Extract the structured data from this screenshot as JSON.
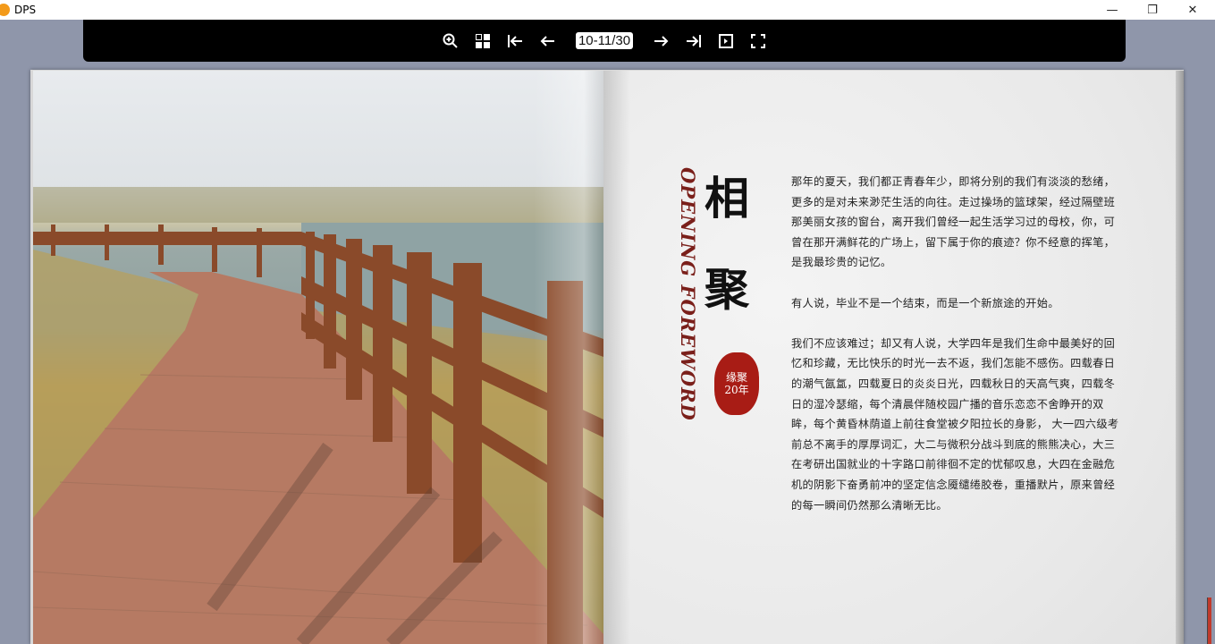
{
  "window": {
    "title": "DPS",
    "app_icon": "DPS",
    "controls": {
      "minimize": "—",
      "restore": "❐",
      "close": "✕"
    }
  },
  "toolbar": {
    "page_indicator": "10-11/30",
    "icons": [
      "zoom-in-icon",
      "thumbnails-icon",
      "first-page-icon",
      "prev-page-icon",
      "next-page-icon",
      "last-page-icon",
      "autoplay-icon",
      "fullscreen-icon"
    ]
  },
  "page": {
    "vertical_title": "OPENING FOREWORD",
    "title_chars": [
      "相",
      "聚"
    ],
    "stamp": {
      "line1": "缘聚",
      "line2": "20年"
    },
    "paragraphs": [
      "那年的夏天，我们都正青春年少，即将分别的我们有淡淡的愁绪，更多的是对未来渺茫生活的向往。走过操场的篮球架，经过隔壁班那美丽女孩的窗台，离开我们曾经一起生活学习过的母校，你，可曾在那开满鲜花的广场上，留下属于你的痕迹？你不经意的挥笔，是我最珍贵的记忆。",
      "有人说，毕业不是一个结束，而是一个新旅途的开始。",
      "我们不应该难过；却又有人说，大学四年是我们生命中最美好的回忆和珍藏，无比快乐的时光一去不返，我们怎能不感伤。四载春日的潮气氤氲，四载夏日的炎炎日光，四载秋日的天高气爽，四载冬日的湿冷瑟缩，每个清晨伴随校园广播的音乐恋恋不舍睁开的双眸，每个黄昏林荫道上前往食堂被夕阳拉长的身影， 大一四六级考前总不离手的厚厚词汇，大二与微积分战斗到底的熊熊决心，大三在考研出国就业的十字路口前徘徊不定的忧郁叹息，大四在金融危机的阴影下奋勇前冲的坚定信念魇缱绻胶卷，重播默片，原来曾经的每一瞬间仍然那么清晰无比。"
    ]
  }
}
